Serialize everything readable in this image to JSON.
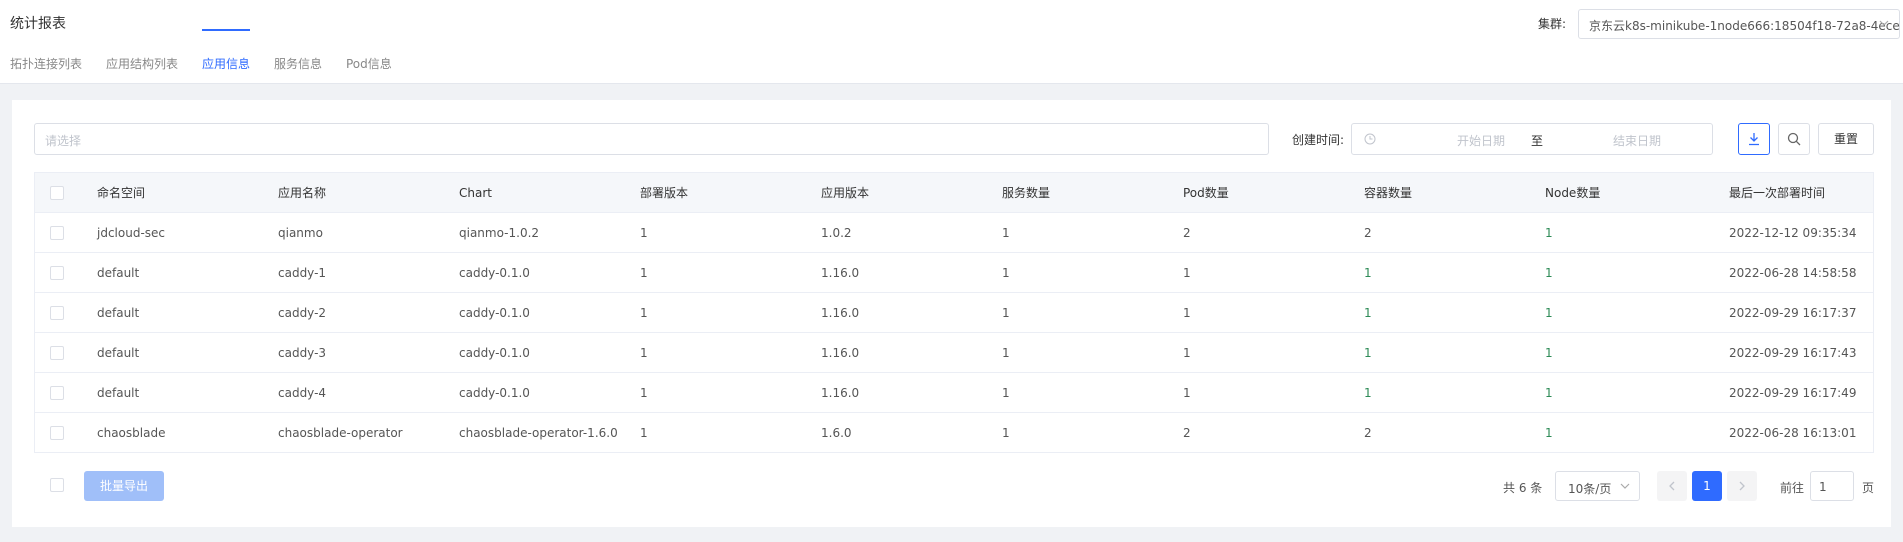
{
  "header": {
    "title": "统计报表",
    "cluster_label": "集群:",
    "cluster_value": "京东云k8s-minikube-1node666:18504f18-72a8-4ece"
  },
  "tabs": [
    {
      "label": "拓扑连接列表",
      "active": false
    },
    {
      "label": "应用结构列表",
      "active": false
    },
    {
      "label": "应用信息",
      "active": true
    },
    {
      "label": "服务信息",
      "active": false
    },
    {
      "label": "Pod信息",
      "active": false
    }
  ],
  "filters": {
    "namespace_placeholder": "请选择",
    "date_label": "创建时间:",
    "date_start_placeholder": "开始日期",
    "date_separator": "至",
    "date_end_placeholder": "结束日期",
    "reset_label": "重置"
  },
  "table": {
    "columns": [
      "命名空间",
      "应用名称",
      "Chart",
      "部署版本",
      "应用版本",
      "服务数量",
      "Pod数量",
      "容器数量",
      "Node数量",
      "最后一次部署时间"
    ],
    "rows": [
      [
        "jdcloud-sec",
        "qianmo",
        "qianmo-1.0.2",
        "1",
        "1.0.2",
        "1",
        "2",
        "2",
        "1",
        "2022-12-12 09:35:34"
      ],
      [
        "default",
        "caddy-1",
        "caddy-0.1.0",
        "1",
        "1.16.0",
        "1",
        "1",
        "1",
        "1",
        "2022-06-28 14:58:58"
      ],
      [
        "default",
        "caddy-2",
        "caddy-0.1.0",
        "1",
        "1.16.0",
        "1",
        "1",
        "1",
        "1",
        "2022-09-29 16:17:37"
      ],
      [
        "default",
        "caddy-3",
        "caddy-0.1.0",
        "1",
        "1.16.0",
        "1",
        "1",
        "1",
        "1",
        "2022-09-29 16:17:43"
      ],
      [
        "default",
        "caddy-4",
        "caddy-0.1.0",
        "1",
        "1.16.0",
        "1",
        "1",
        "1",
        "1",
        "2022-09-29 16:17:49"
      ],
      [
        "chaosblade",
        "chaosblade-operator",
        "chaosblade-operator-1.6.0",
        "1",
        "1.6.0",
        "1",
        "2",
        "2",
        "1",
        "2022-06-28 16:13:01"
      ]
    ]
  },
  "footer": {
    "export_label": "批量导出",
    "total_text": "共 6 条",
    "page_size": "10条/页",
    "current_page": "1",
    "goto_label": "前往",
    "goto_value": "1",
    "goto_suffix": "页"
  },
  "colors": {
    "accent": "#2f6bff",
    "count_green": "#2e8b57"
  }
}
